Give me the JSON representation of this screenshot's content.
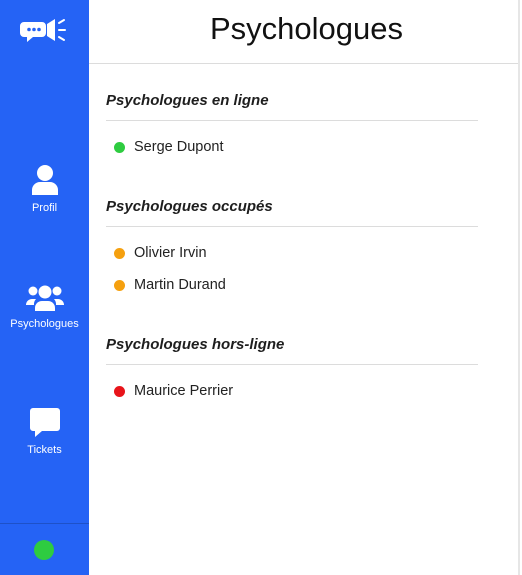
{
  "colors": {
    "sidebar": "#2563f5",
    "online": "#2ecc40",
    "busy": "#f5a00f",
    "offline": "#e8141a"
  },
  "sidebar": {
    "logo_icon": "megaphone-chat-icon",
    "items": [
      {
        "label": "Profil",
        "icon": "user-icon"
      },
      {
        "label": "Psychologues",
        "icon": "users-icon"
      },
      {
        "label": "Tickets",
        "icon": "chat-bubble-icon"
      }
    ],
    "self_status": "online"
  },
  "page": {
    "title": "Psychologues"
  },
  "sections": [
    {
      "title": "Psychologues en ligne",
      "status": "online",
      "members": [
        "Serge Dupont"
      ]
    },
    {
      "title": "Psychologues occupés",
      "status": "busy",
      "members": [
        "Olivier Irvin",
        "Martin Durand"
      ]
    },
    {
      "title": "Psychologues hors-ligne",
      "status": "offline",
      "members": [
        "Maurice Perrier"
      ]
    }
  ]
}
